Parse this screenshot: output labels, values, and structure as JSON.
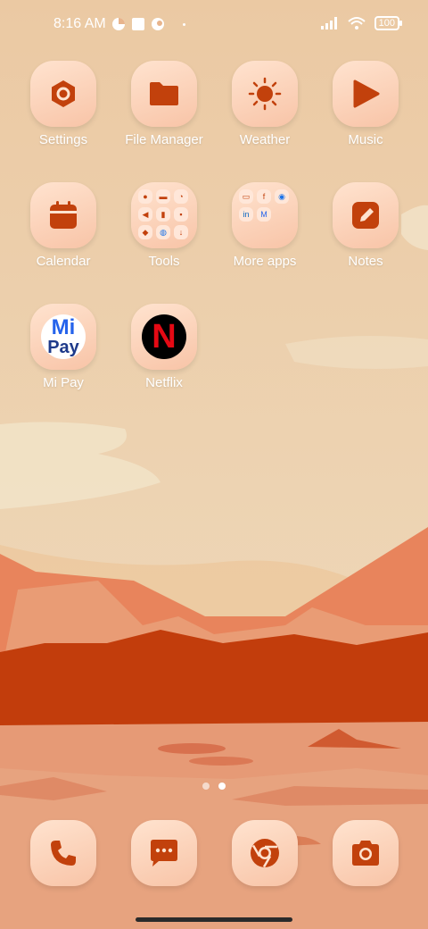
{
  "status": {
    "time": "8:16 AM",
    "battery": "100"
  },
  "apps": [
    {
      "label": "Settings",
      "icon": "settings-icon"
    },
    {
      "label": "File Manager",
      "icon": "folder-icon"
    },
    {
      "label": "Weather",
      "icon": "sun-icon"
    },
    {
      "label": "Music",
      "icon": "play-icon"
    },
    {
      "label": "Calendar",
      "icon": "calendar-icon"
    },
    {
      "label": "Tools",
      "icon": "tools-folder-icon"
    },
    {
      "label": "More apps",
      "icon": "more-apps-folder-icon"
    },
    {
      "label": "Notes",
      "icon": "notes-icon"
    },
    {
      "label": "Mi Pay",
      "icon": "mi-pay-icon"
    },
    {
      "label": "Netflix",
      "icon": "netflix-icon"
    }
  ],
  "mipay_logo_text": [
    "Mi",
    "Pay"
  ],
  "netflix_letter": "N",
  "dock": [
    {
      "name": "Phone",
      "icon": "phone-icon"
    },
    {
      "name": "Messages",
      "icon": "chat-icon"
    },
    {
      "name": "Chrome",
      "icon": "chrome-icon"
    },
    {
      "name": "Camera",
      "icon": "camera-icon"
    }
  ],
  "pages": {
    "count": 2,
    "active": 1
  },
  "colors": {
    "accent": "#c2410c",
    "sky_top": "#ebc9a3",
    "sky_bottom": "#efdcbf",
    "mountain": "#e6805a",
    "cliff": "#c23d0c",
    "ground": "#e69a76"
  }
}
